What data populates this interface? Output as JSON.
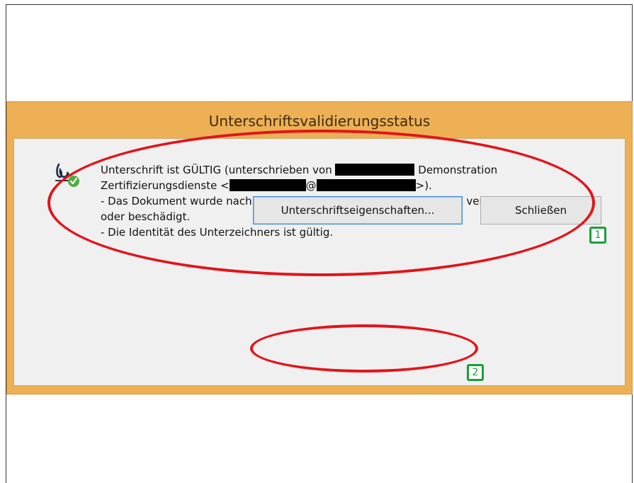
{
  "dialog": {
    "title": "Unterschriftsvalidierungsstatus",
    "message": {
      "line1_prefix": "Unterschrift ist GÜLTIG (unterschrieben von",
      "line1_suffix": "Demonstration",
      "line2_prefix": "Zertifizierungsdienste <",
      "line2_at": "@",
      "line2_suffix": ">).",
      "line3": "- Das Dokument wurde nach dem Anbringen der Zertifizierung nicht verändert",
      "line4": "oder beschädigt.",
      "line5": "- Die Identität des Unterzeichners ist gültig."
    },
    "status_icon": "signature-valid-icon",
    "buttons": {
      "properties_label": "Unterschriftseigenschaften...",
      "close_label": "Schließen"
    }
  },
  "annotations": {
    "label_1": "1",
    "label_2": "2",
    "ellipse_color": "#e3141a",
    "label_color": "#1a9f3a"
  },
  "colors": {
    "window_frame": "#edb054",
    "client_background": "#f0f0f0",
    "button_focus_border": "#3c8fd6"
  }
}
